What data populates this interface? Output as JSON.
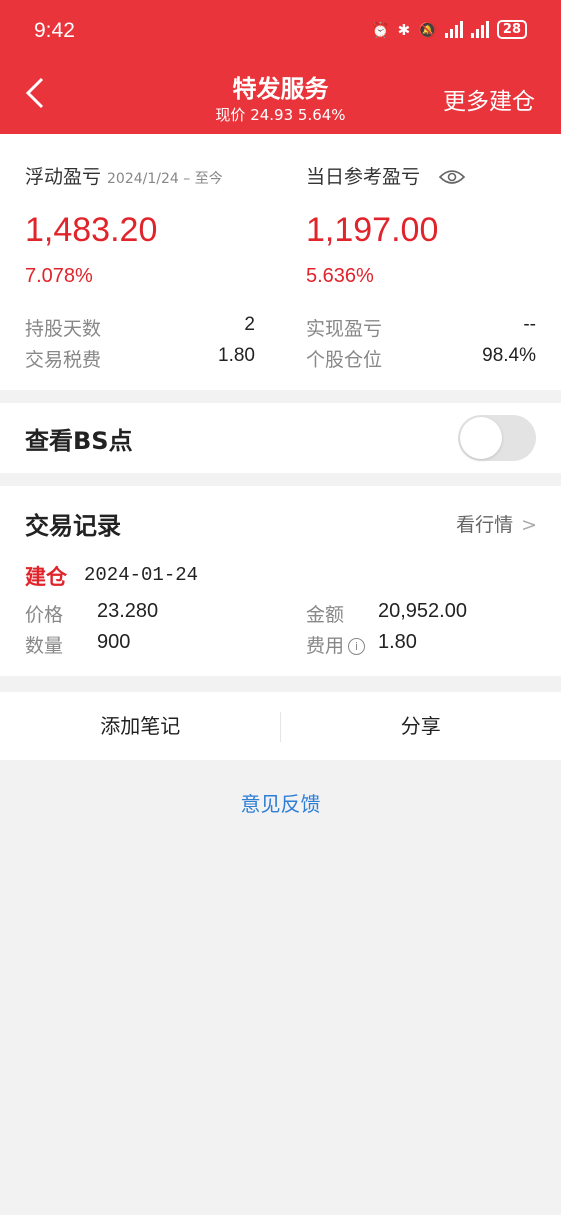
{
  "status_bar": {
    "time": "9:42",
    "battery": "28"
  },
  "nav": {
    "back_icon": "chevron-left-icon",
    "title": "特发服务",
    "subtitle": "现价 24.93 5.64%",
    "more_action": "更多建仓"
  },
  "pnl": {
    "floating_label": "浮动盈亏",
    "floating_period": "2024/1/24 – 至今",
    "floating_value": "1,483.20",
    "floating_pct": "7.078%",
    "daily_label": "当日参考盈亏",
    "daily_value": "1,197.00",
    "daily_pct": "5.636%",
    "stats": [
      {
        "label": "持股天数",
        "value": "2"
      },
      {
        "label": "交易税费",
        "value": "1.80"
      },
      {
        "label": "实现盈亏",
        "value": "--"
      },
      {
        "label": "个股仓位",
        "value": "98.4%"
      }
    ]
  },
  "bs_points": {
    "label": "查看BS点",
    "enabled": false
  },
  "records": {
    "title": "交易记录",
    "link": "看行情",
    "entry": {
      "type": "建仓",
      "date": "2024-01-24",
      "price_label": "价格",
      "price": "23.280",
      "amount_label": "金额",
      "amount": "20,952.00",
      "qty_label": "数量",
      "qty": "900",
      "fee_label": "费用",
      "fee": "1.80"
    }
  },
  "actions": {
    "add_note": "添加笔记",
    "share": "分享"
  },
  "feedback": "意见反馈",
  "colors": {
    "header": "#e8343a",
    "profit": "#e0242b",
    "link": "#2f7fd6"
  }
}
